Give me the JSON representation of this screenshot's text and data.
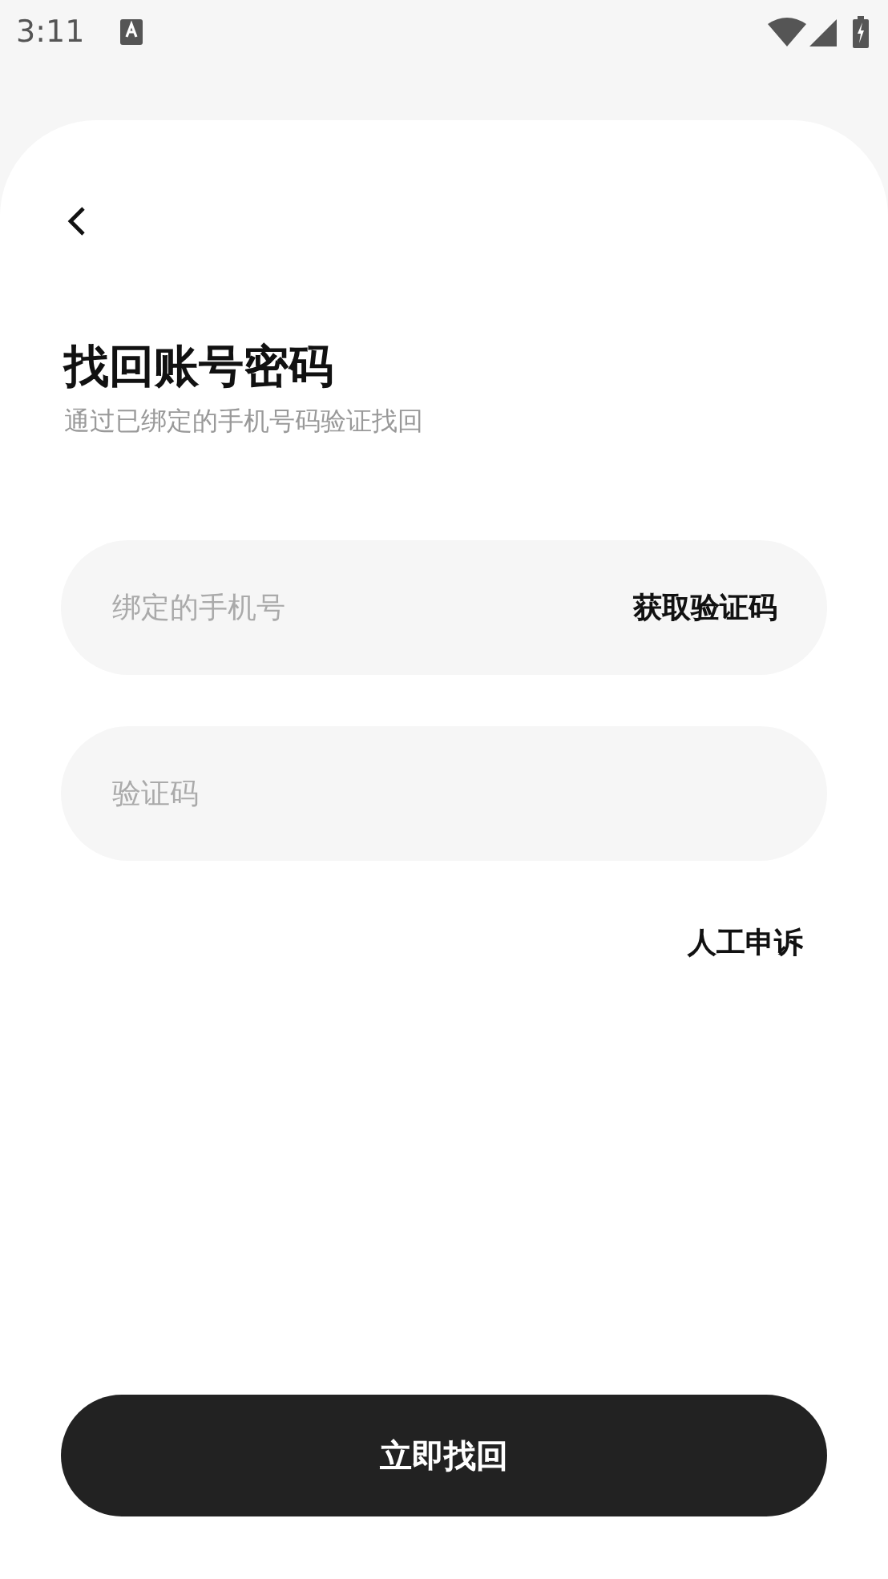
{
  "status_bar": {
    "time": "3:11"
  },
  "header": {
    "title": "找回账号密码",
    "subtitle": "通过已绑定的手机号码验证找回"
  },
  "phone_field": {
    "placeholder": "绑定的手机号",
    "action": "获取验证码"
  },
  "code_field": {
    "placeholder": "验证码"
  },
  "appeal_link": "人工申诉",
  "submit_button": "立即找回"
}
